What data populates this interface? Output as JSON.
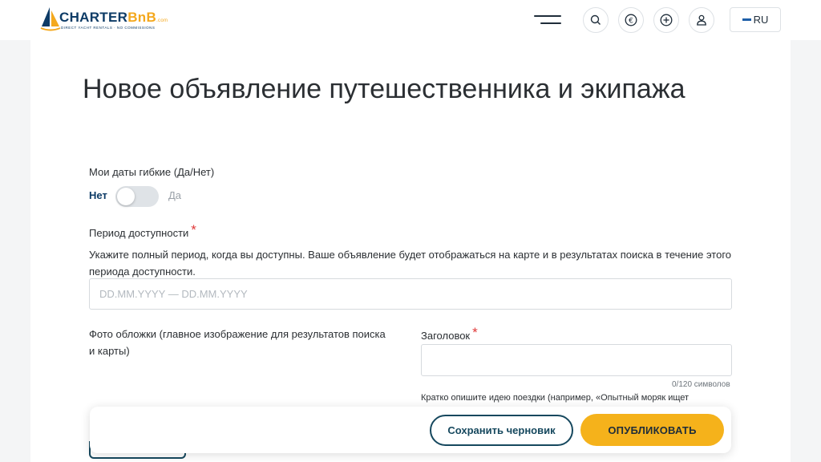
{
  "header": {
    "logo": {
      "brand_main": "CHARTER",
      "brand_accent": "BnB",
      "brand_suffix": ".com",
      "tagline": "DIRECT YACHT RENTALS · NO COMMISSIONS"
    },
    "icons": [
      "menu-icon",
      "search-icon",
      "euro-icon",
      "add-icon",
      "user-icon"
    ],
    "language": "RU"
  },
  "form": {
    "title": "Новое объявление путешественника и экипажа",
    "flexible_dates": {
      "label": "Мои даты гибкие (Да/Нет)",
      "off_label": "Нет",
      "on_label": "Да",
      "value": false
    },
    "availability": {
      "label": "Период доступности",
      "required_mark": "*",
      "help": "Укажите полный период, когда вы доступны. Ваше объявление будет отображаться на карте и в результатах поиска в течение этого периода доступности.",
      "placeholder": "DD.MM.YYYY — DD.MM.YYYY",
      "value": ""
    },
    "cover_photo": {
      "label": "Фото обложки (главное изображение для результатов поиска и карты)"
    },
    "headline": {
      "label": "Заголовок",
      "required_mark": "*",
      "value": "",
      "counter": "0/120 символов",
      "hint": "Кратко опишите идею поездки (например, «Опытный моряк ищет"
    }
  },
  "actions": {
    "save_draft": "Сохранить черновик",
    "publish": "ОПУБЛИКОВАТЬ"
  },
  "colors": {
    "brand_navy": "#16485e",
    "accent_yellow": "#f5b21b",
    "required_red": "#e03a3a"
  }
}
